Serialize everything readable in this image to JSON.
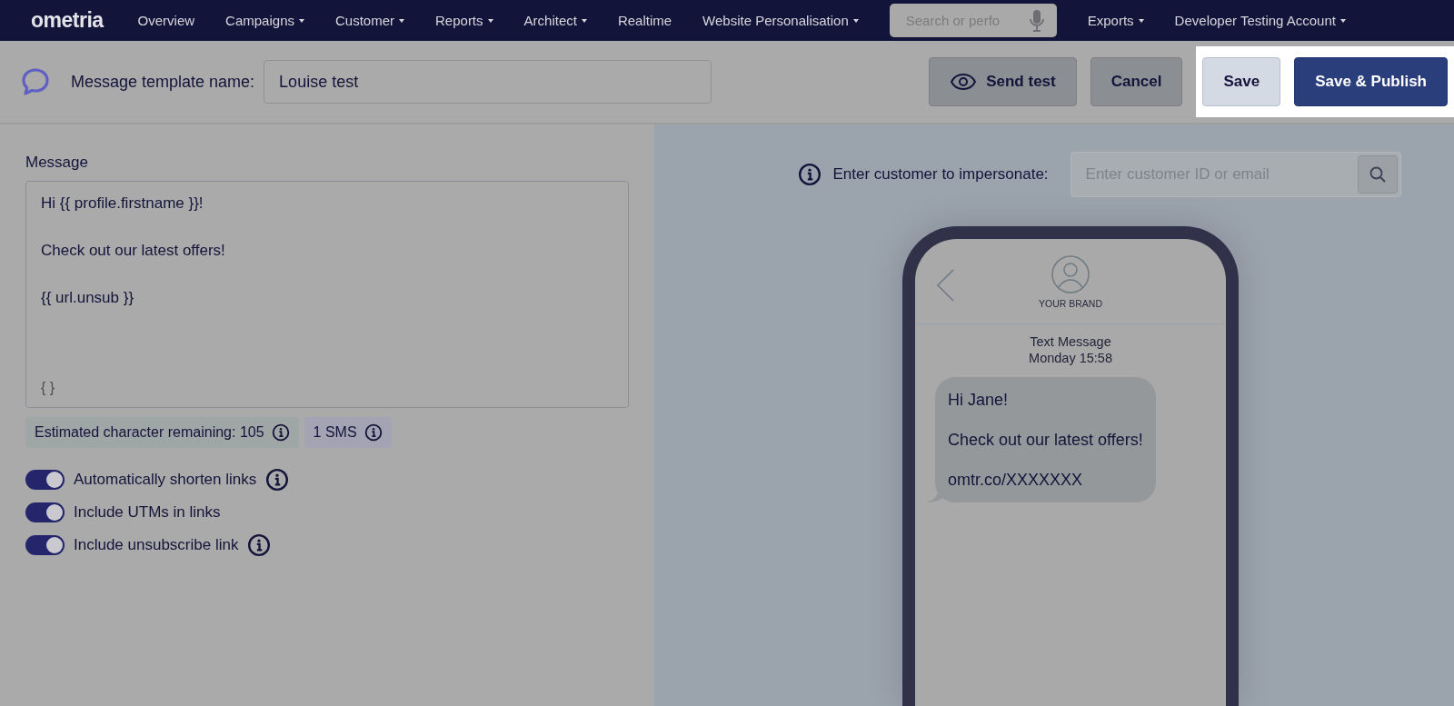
{
  "nav": {
    "logo": "ometria",
    "items": [
      {
        "label": "Overview",
        "has_menu": false
      },
      {
        "label": "Campaigns",
        "has_menu": true
      },
      {
        "label": "Customer",
        "has_menu": true
      },
      {
        "label": "Reports",
        "has_menu": true
      },
      {
        "label": "Architect",
        "has_menu": true
      },
      {
        "label": "Realtime",
        "has_menu": false
      },
      {
        "label": "Website Personalisation",
        "has_menu": true
      }
    ],
    "search": {
      "placeholder": "Search or perfo"
    },
    "right_items": [
      {
        "label": "Exports",
        "has_menu": true
      },
      {
        "label": "Developer Testing Account",
        "has_menu": true
      }
    ]
  },
  "header": {
    "name_label": "Message template name:",
    "name_value": "Louise test",
    "buttons": [
      {
        "label": "Send test",
        "kind": "secondary",
        "icon": true,
        "highlighted": false
      },
      {
        "label": "Cancel",
        "kind": "secondary",
        "icon": false,
        "highlighted": false
      },
      {
        "label": "Save",
        "kind": "light",
        "icon": false,
        "highlighted": true
      },
      {
        "label": "Save & Publish",
        "kind": "primary",
        "icon": false,
        "highlighted": true
      }
    ]
  },
  "editor": {
    "label": "Message",
    "lines": [
      "Hi {{ profile.firstname }}!",
      "Check out our latest offers!",
      "{{ url.unsub }}"
    ],
    "variable_button": "{ }",
    "chips": [
      {
        "text": "Estimated character remaining: 105",
        "kind": "count"
      },
      {
        "text": "1 SMS",
        "kind": "segments"
      }
    ],
    "toggles": [
      {
        "label": "Automatically shorten links",
        "on": true,
        "info": true
      },
      {
        "label": "Include UTMs in links",
        "on": true,
        "info": false
      },
      {
        "label": "Include unsubscribe link",
        "on": true,
        "info": true
      }
    ]
  },
  "preview": {
    "impersonate_label": "Enter customer to impersonate:",
    "placeholder": "Enter customer ID or email",
    "phone": {
      "brand": "YOUR BRAND",
      "title": "Text Message",
      "time": "Monday 15:58",
      "bubble": [
        "Hi Jane!",
        "Check out our latest offers!",
        "omtr.co/XXXXXXX"
      ]
    }
  }
}
